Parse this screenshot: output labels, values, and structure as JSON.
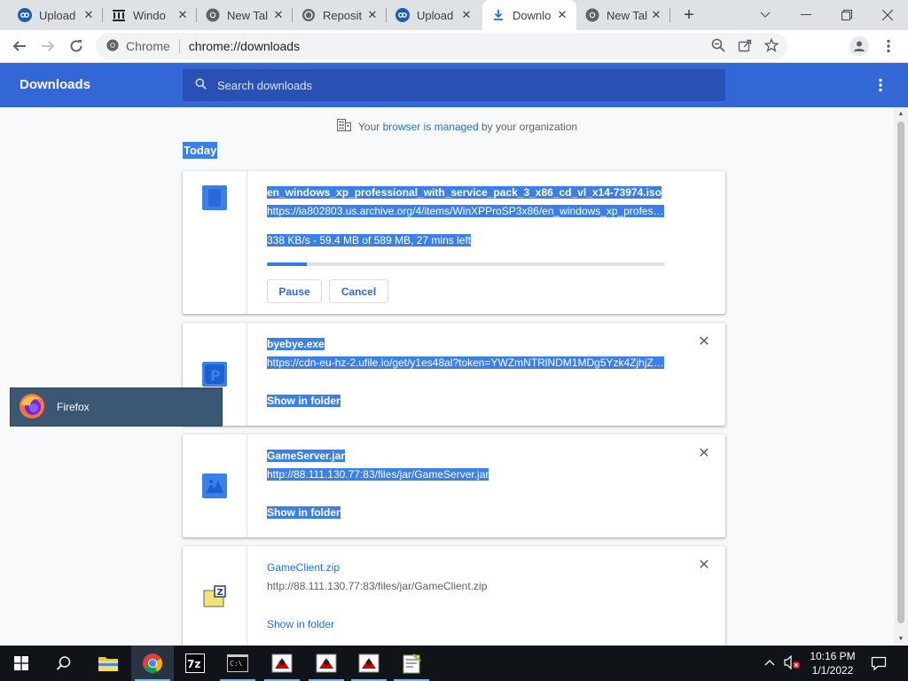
{
  "colors": {
    "header_blue": "#3367d6",
    "link_blue": "#1a73e8",
    "selection": "#3b80e8"
  },
  "tabs": [
    {
      "title": "Upload",
      "icon": "cloud-upload-icon",
      "active": false
    },
    {
      "title": "Windo",
      "icon": "archive-building-icon",
      "active": false
    },
    {
      "title": "New Tal",
      "icon": "chrome-icon",
      "active": false
    },
    {
      "title": "Reposit",
      "icon": "globe-icon",
      "active": false
    },
    {
      "title": "Upload",
      "icon": "cloud-upload-icon",
      "active": false
    },
    {
      "title": "Downlo",
      "icon": "download-icon",
      "active": true
    },
    {
      "title": "New Tal",
      "icon": "chrome-icon",
      "active": false
    }
  ],
  "toolbar": {
    "site_label": "Chrome",
    "url": "chrome://downloads"
  },
  "downloads_page": {
    "title": "Downloads",
    "search_placeholder": "Search downloads",
    "managed_prefix": "Your ",
    "managed_link": "browser is managed",
    "managed_suffix": " by your organization",
    "date_header": "Today"
  },
  "downloads": [
    {
      "name": "en_windows_xp_professional_with_service_pack_3_x86_cd_vl_x14-73974.iso",
      "url": "https://ia802803.us.archive.org/4/items/WinXPProSP3x86/en_windows_xp_professi...",
      "status": "338 KB/s - 59.4 MB of 589 MB, 27 mins left",
      "progress": 0.101,
      "pause_label": "Pause",
      "cancel_label": "Cancel"
    },
    {
      "name": "byebye.exe",
      "url": "https://cdn-eu-hz-2.ufile.io/get/y1es48al?token=YWZmNTRlNDM1MDg5Yzk4ZjhjZml...",
      "action_label": "Show in folder"
    },
    {
      "name": "GameServer.jar",
      "url": "http://88.111.130.77:83/files/jar/GameServer.jar",
      "action_label": "Show in folder"
    },
    {
      "name": "GameClient.zip",
      "url": "http://88.111.130.77:83/files/jar/GameClient.zip",
      "action_label": "Show in folder"
    }
  ],
  "tooltip": {
    "app_name": "Firefox"
  },
  "taskbar": {
    "time": "10:16 PM",
    "date": "1/1/2022",
    "pinned": [
      "windows-start-icon",
      "search-icon",
      "file-explorer-icon",
      "chrome-icon",
      "7zip-icon",
      "command-prompt-icon",
      "java-icon",
      "java-icon",
      "java-icon",
      "notepad-plus-icon"
    ]
  }
}
